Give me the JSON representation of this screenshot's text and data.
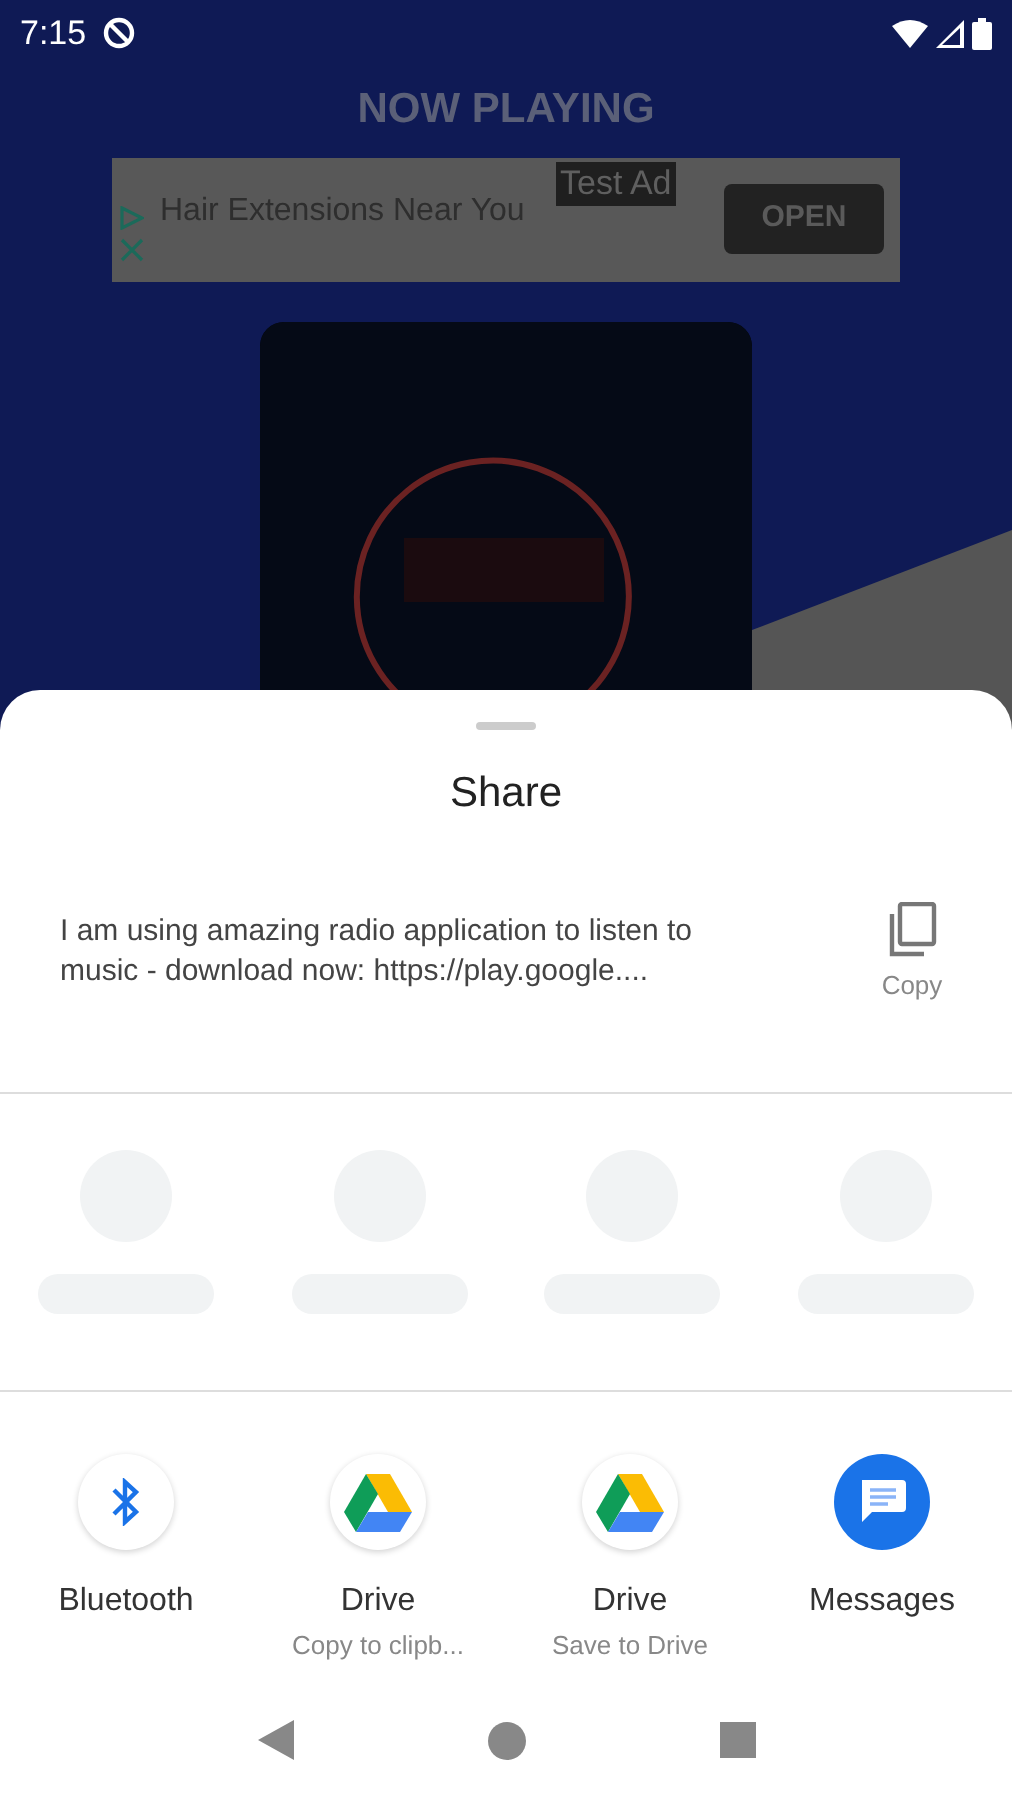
{
  "status_bar": {
    "time": "7:15"
  },
  "screen_title": "NOW PLAYING",
  "ad": {
    "badge": "Test Ad",
    "headline": "Hair Extensions Near You",
    "button": "OPEN"
  },
  "share_sheet": {
    "title": "Share",
    "message": "I am using amazing radio application to listen to music - download now: https://play.google....",
    "copy_label": "Copy",
    "targets": [
      {
        "kind": "bluetooth",
        "label": "Bluetooth"
      },
      {
        "kind": "drive",
        "label": "Drive",
        "sublabel": "Copy to clipb..."
      },
      {
        "kind": "drive",
        "label": "Drive",
        "sublabel": "Save to Drive"
      },
      {
        "kind": "messages",
        "label": "Messages"
      }
    ]
  }
}
